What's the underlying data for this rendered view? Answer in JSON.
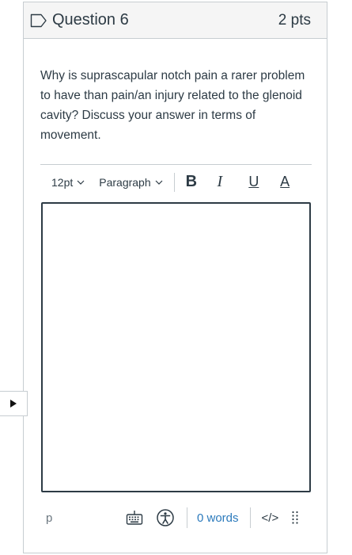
{
  "question": {
    "title": "Question 6",
    "points": "2 pts",
    "text": "Why is suprascapular notch pain a rarer problem to have than pain/an injury related to the glenoid cavity? Discuss your answer in terms of movement."
  },
  "toolbar": {
    "font_size": "12pt",
    "block_format": "Paragraph",
    "bold": "B",
    "italic": "I",
    "underline": "U",
    "text_color": "A"
  },
  "statusbar": {
    "path": "p",
    "word_count": "0 words",
    "html_toggle": "</>"
  },
  "icons": {
    "flag": "flag-outline-icon",
    "keyboard": "keyboard-icon",
    "accessibility": "accessibility-icon",
    "resize": "resize-grip-icon",
    "play": "play-icon"
  },
  "colors": {
    "text": "#2d3b45",
    "border": "#c7cdd1",
    "link": "#2b7abc",
    "header_bg": "#f5f5f5"
  }
}
